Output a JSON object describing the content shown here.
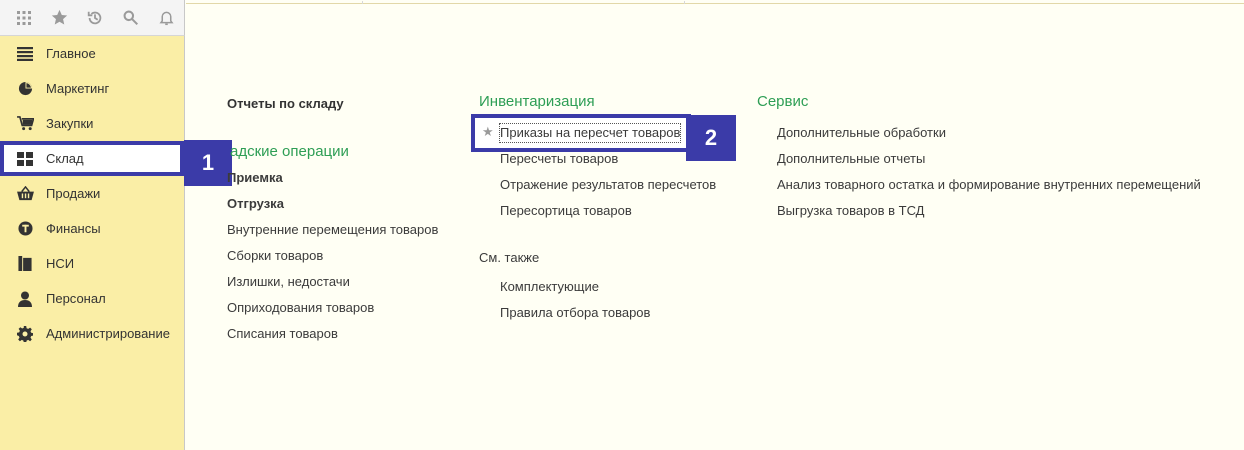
{
  "toolbar": {
    "icons": [
      "apps-grid-icon",
      "favorites-star-icon",
      "history-icon",
      "search-icon",
      "notifications-bell-icon"
    ]
  },
  "sidebar": {
    "items": [
      {
        "label": "Главное",
        "icon": "menu-lines-icon"
      },
      {
        "label": "Маркетинг",
        "icon": "pie-chart-icon"
      },
      {
        "label": "Закупки",
        "icon": "cart-icon"
      },
      {
        "label": "Склад",
        "icon": "warehouse-grid-icon",
        "active": true
      },
      {
        "label": "Продажи",
        "icon": "basket-icon"
      },
      {
        "label": "Финансы",
        "icon": "finance-coin-icon"
      },
      {
        "label": "НСИ",
        "icon": "reference-data-icon"
      },
      {
        "label": "Персонал",
        "icon": "person-icon"
      },
      {
        "label": "Администрирование",
        "icon": "gear-icon"
      }
    ]
  },
  "markers": {
    "one": "1",
    "two": "2"
  },
  "col1": {
    "reports": "Отчеты по складу",
    "ops_heading": "адские операции",
    "items": [
      "Приемка",
      "Отгрузка",
      "Внутренние перемещения товаров",
      "Сборки товаров",
      "Излишки, недостачи",
      "Оприходования товаров",
      "Списания товаров"
    ]
  },
  "col2": {
    "heading": "Инвентаризация",
    "highlighted": "Приказы на пересчет товаров",
    "items": [
      "Пересчеты товаров",
      "Отражение результатов пересчетов",
      "Пересортица товаров"
    ],
    "see_also": "См. также",
    "see_items": [
      "Комплектующие",
      "Правила отбора товаров"
    ]
  },
  "col3": {
    "heading": "Сервис",
    "items": [
      "Дополнительные обработки",
      "Дополнительные отчеты",
      "Анализ товарного остатка и формирование внутренних перемещений",
      "Выгрузка товаров в ТСД"
    ]
  },
  "colors": {
    "accent_green": "#2e9e55",
    "marker_blue": "#3b3ba8",
    "sidebar_yellow": "#faeea6"
  }
}
